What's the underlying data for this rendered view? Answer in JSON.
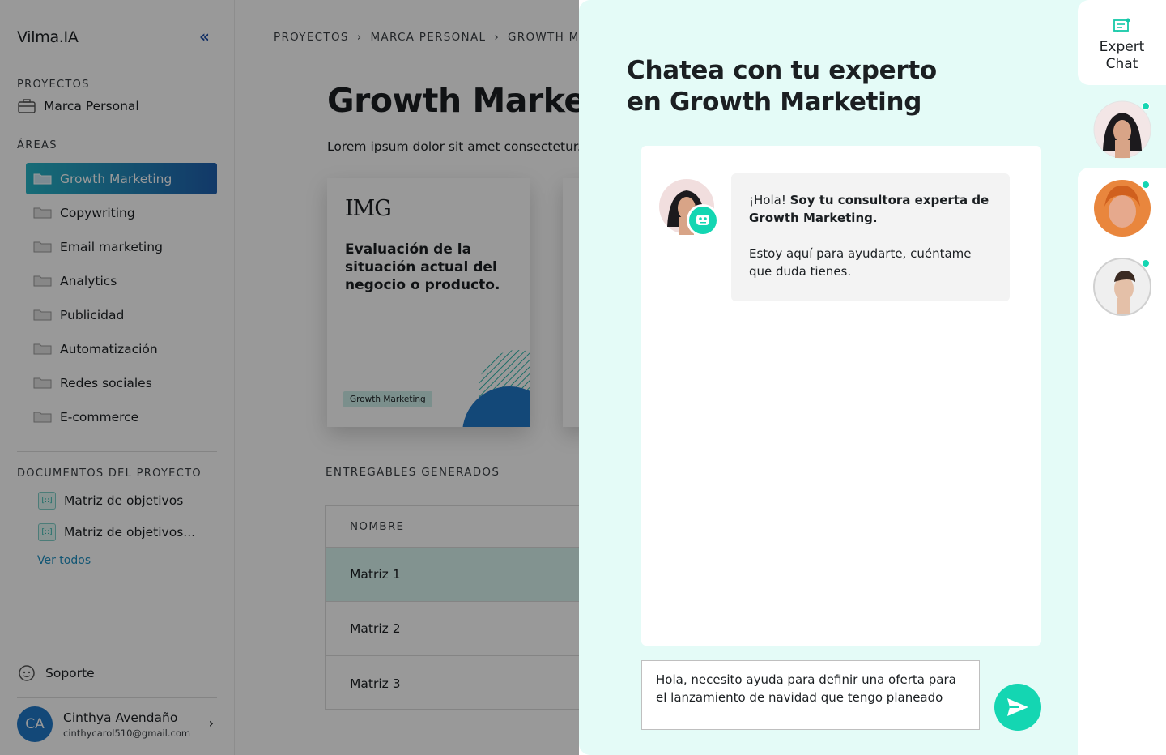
{
  "sidebar": {
    "logo": "Vilma.IA",
    "collapse_icon": "«",
    "projects_heading": "PROYECTOS",
    "project_name": "Marca Personal",
    "areas_heading": "ÁREAS",
    "areas": [
      {
        "label": "Growth Marketing"
      },
      {
        "label": "Copywriting"
      },
      {
        "label": "Email marketing"
      },
      {
        "label": "Analytics"
      },
      {
        "label": "Publicidad"
      },
      {
        "label": "Automatización"
      },
      {
        "label": "Redes sociales"
      },
      {
        "label": "E-commerce"
      }
    ],
    "documents_heading": "DOCUMENTOS DEL PROYECTO",
    "documents": [
      {
        "label": "Matriz de objetivos"
      },
      {
        "label": "Matriz de objetivos..."
      }
    ],
    "see_all": "Ver todos",
    "support": "Soporte",
    "user": {
      "initials": "CA",
      "name": "Cinthya Avendaño",
      "email": "cinthycarol510@gmail.com"
    }
  },
  "main": {
    "breadcrumb": [
      "PROYECTOS",
      "MARCA PERSONAL",
      "GROWTH MA"
    ],
    "title": "Growth Marketin",
    "description": "Lorem ipsum dolor sit amet consectetur. G",
    "card": {
      "brand": "IMG",
      "text": "Evaluación de la situación actual del negocio o producto.",
      "tag": "Growth Marketing"
    },
    "deliverables_heading": "ENTREGABLES GENERADOS",
    "table": {
      "header": "NOMBRE",
      "rows": [
        "Matriz 1",
        "Matriz 2",
        "Matriz 3"
      ]
    }
  },
  "chat": {
    "title": "Chatea con tu experto en Growth Marketing",
    "greeting_plain": "¡Hola! ",
    "greeting_bold": "Soy tu consultora experta de Growth Marketing.",
    "message_2": "Estoy aquí para ayudarte, cuéntame que duda tienes.",
    "input_value": "Hola, necesito ayuda para definir una oferta para el lanzamiento de navidad que tengo planeado"
  },
  "rail": {
    "expert_chat_line1": "Expert",
    "expert_chat_line2": "Chat"
  },
  "colors": {
    "accent": "#14d6b2",
    "active_gradient_start": "#27b4c6",
    "active_gradient_end": "#1f5fae",
    "panel_bg": "#e4fbf7",
    "avatar_bg": "#2178c8"
  }
}
